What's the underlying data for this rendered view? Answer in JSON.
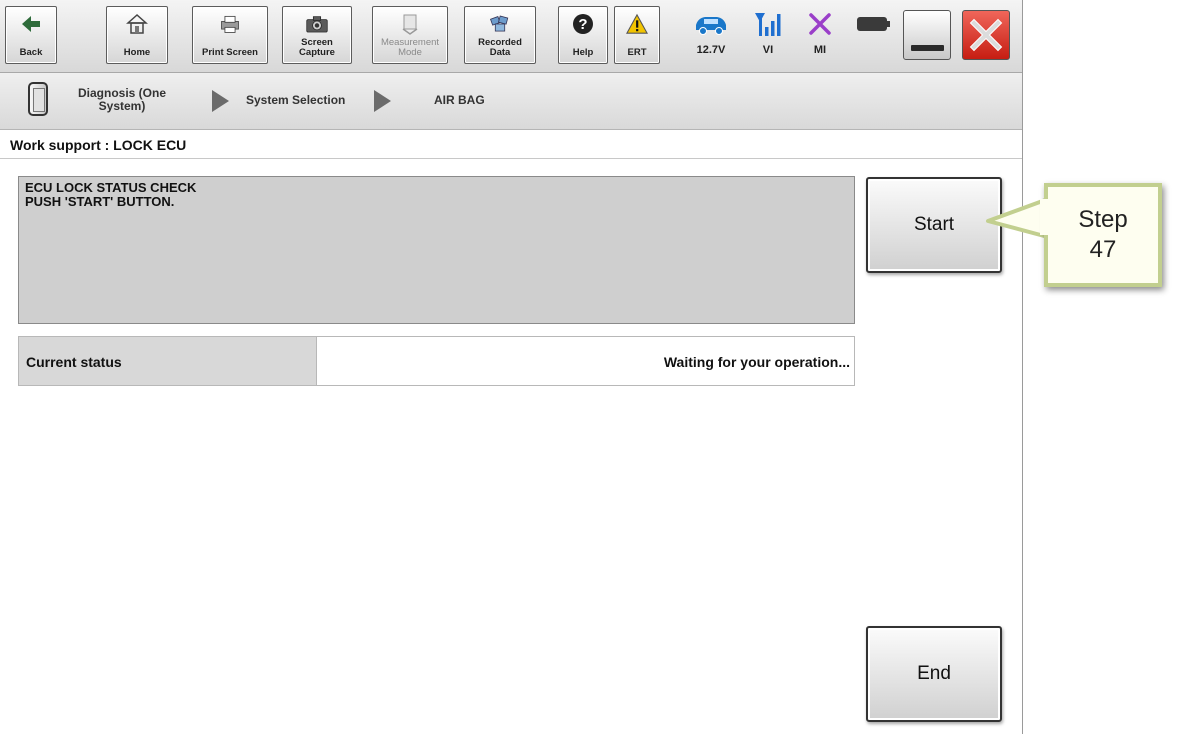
{
  "toolbar": {
    "back": "Back",
    "home": "Home",
    "print_screen": "Print Screen",
    "screen_capture_1": "Screen",
    "screen_capture_2": "Capture",
    "measurement_mode_1": "Measurement",
    "measurement_mode_2": "Mode",
    "recorded_data_1": "Recorded",
    "recorded_data_2": "Data",
    "help": "Help",
    "ert": "ERT"
  },
  "status": {
    "battery_voltage": "12.7V",
    "vi": "VI",
    "mi": "MI"
  },
  "breadcrumb": {
    "step1_line1": "Diagnosis (One",
    "step1_line2": "System)",
    "step2": "System Selection",
    "step3": "AIR BAG"
  },
  "page_title": "Work support : LOCK ECU",
  "message": {
    "line1": "ECU LOCK STATUS CHECK",
    "line2": "PUSH 'START' BUTTON."
  },
  "current_status": {
    "label": "Current status",
    "value": "Waiting for your operation..."
  },
  "buttons": {
    "start": "Start",
    "end": "End"
  },
  "callout": {
    "line1": "Step",
    "line2": "47"
  },
  "icons": {
    "back": "back-arrow-icon",
    "home": "home-icon",
    "print": "printer-icon",
    "camera": "camera-icon",
    "measurement": "measurement-icon",
    "recorded": "recorded-data-icon",
    "help": "help-icon",
    "ert": "warning-icon",
    "car": "car-icon",
    "signal": "signal-icon",
    "mi": "mi-x-icon",
    "battery": "battery-icon"
  },
  "colors": {
    "car_blue": "#1a77c9",
    "signal_blue": "#1f6fd0",
    "mi_purple": "#9a3fc9",
    "close_red": "#d9261c",
    "warning_yellow": "#f2c400",
    "callout_border": "#c2cf8f"
  }
}
